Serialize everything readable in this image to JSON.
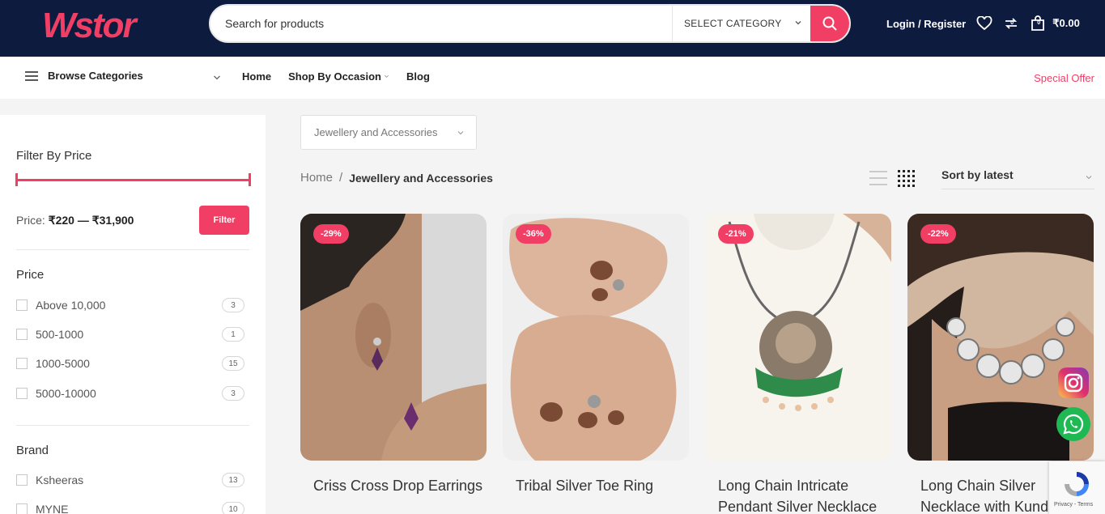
{
  "brand": {
    "logo_text": "Wstor",
    "logo_color": "#f03e65"
  },
  "header": {
    "search_placeholder": "Search for products",
    "category_select": "SELECT CATEGORY",
    "login_label": "Login / Register",
    "compare_count": "0",
    "cart_count": "0",
    "cart_total": "₹0.00",
    "bg_color": "#0d1b3e",
    "accent_color": "#f03e65"
  },
  "nav": {
    "browse_label": "Browse Categories",
    "links": [
      "Home",
      "Shop By Occasion",
      "Blog"
    ],
    "special_offer": "Special Offer"
  },
  "sidebar": {
    "filter_title": "Filter By Price",
    "price_prefix": "Price:",
    "price_range": "₹220 — ₹31,900",
    "filter_button": "Filter",
    "price_title": "Price",
    "price_options": [
      {
        "label": "Above 10,000",
        "count": "3"
      },
      {
        "label": "500-1000",
        "count": "1"
      },
      {
        "label": "1000-5000",
        "count": "15"
      },
      {
        "label": "5000-10000",
        "count": "3"
      }
    ],
    "brand_title": "Brand",
    "brand_options": [
      {
        "label": "Ksheeras",
        "count": "13"
      },
      {
        "label": "MYNE",
        "count": "10"
      }
    ]
  },
  "main": {
    "category_dropdown": "Jewellery and Accessories",
    "breadcrumb_home": "Home",
    "breadcrumb_sep": "/",
    "breadcrumb_current": "Jewellery and Accessories",
    "sort_label": "Sort by latest",
    "products": [
      {
        "discount": "-29%",
        "title": "Criss Cross Drop Earrings"
      },
      {
        "discount": "-36%",
        "title": "Tribal Silver Toe Ring"
      },
      {
        "discount": "-21%",
        "title": "Long Chain Intricate Pendant Silver Necklace"
      },
      {
        "discount": "-22%",
        "title": "Long Chain Silver Necklace with Kundan"
      }
    ]
  },
  "recaptcha_text": "Privacy - Terms"
}
